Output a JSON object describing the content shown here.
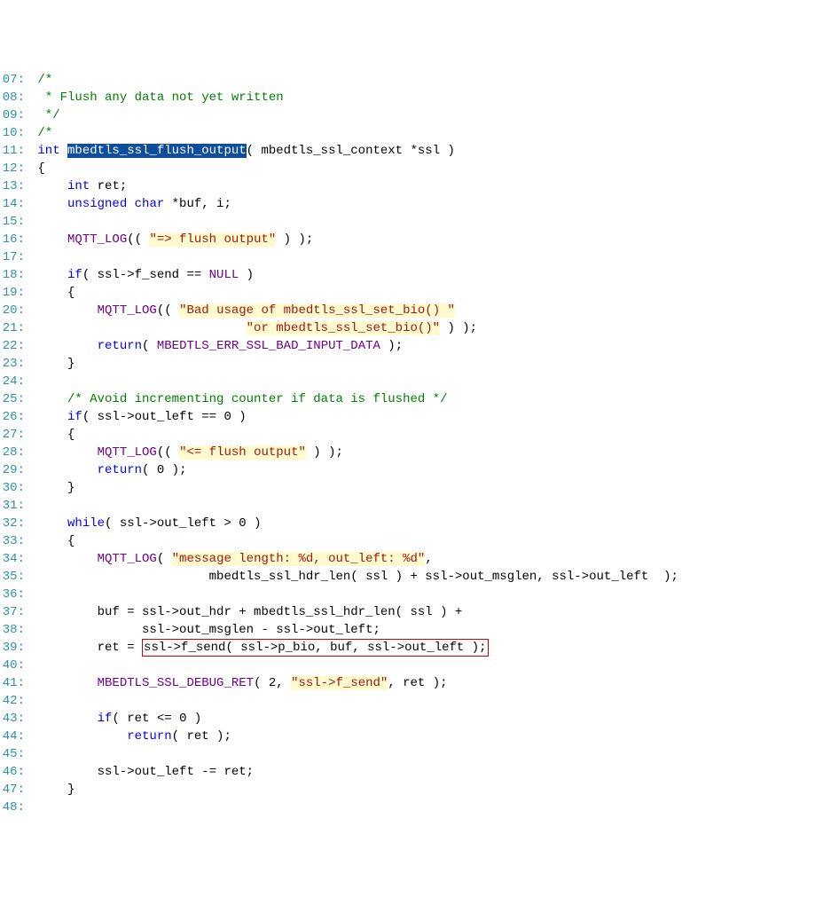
{
  "lines": [
    {
      "n": "07:",
      "prefix": "",
      "tokens": [
        [
          "/*",
          "comment"
        ]
      ]
    },
    {
      "n": "08:",
      "prefix": "",
      "tokens": [
        [
          " * Flush any data not yet written",
          "comment"
        ]
      ]
    },
    {
      "n": "09:",
      "prefix": "",
      "tokens": [
        [
          " */",
          "comment"
        ]
      ]
    },
    {
      "n": "10:",
      "prefix": "",
      "tokens": [
        [
          "/*",
          "comment"
        ]
      ]
    },
    {
      "n": "11:",
      "prefix": "",
      "tokens": [
        [
          "int ",
          "keyword"
        ],
        [
          "mbedtls_ssl_flush_output",
          "select"
        ],
        [
          "( mbedtls_ssl_context *ssl )",
          "text"
        ]
      ]
    },
    {
      "n": "12:",
      "prefix": "",
      "tokens": [
        [
          "{",
          "text"
        ]
      ]
    },
    {
      "n": "13:",
      "prefix": "    ",
      "tokens": [
        [
          "int",
          "keyword"
        ],
        [
          " ret;",
          "text"
        ]
      ]
    },
    {
      "n": "14:",
      "prefix": "    ",
      "tokens": [
        [
          "unsigned",
          "keyword"
        ],
        [
          " ",
          "text"
        ],
        [
          "char",
          "keyword"
        ],
        [
          " *buf, i;",
          "text"
        ]
      ]
    },
    {
      "n": "15:",
      "prefix": "",
      "tokens": [
        [
          "",
          "text"
        ]
      ]
    },
    {
      "n": "16:",
      "prefix": "    ",
      "tokens": [
        [
          "MQTT_LOG",
          "macro"
        ],
        [
          "(( ",
          "text"
        ],
        [
          "\"=> flush output\"",
          "string hl"
        ],
        [
          " ) );",
          "text"
        ]
      ]
    },
    {
      "n": "17:",
      "prefix": "",
      "tokens": [
        [
          "",
          "text"
        ]
      ]
    },
    {
      "n": "18:",
      "prefix": "    ",
      "tokens": [
        [
          "if",
          "keyword"
        ],
        [
          "( ssl->f_send == ",
          "text"
        ],
        [
          "NULL",
          "macro"
        ],
        [
          " )",
          "text"
        ]
      ]
    },
    {
      "n": "19:",
      "prefix": "    ",
      "tokens": [
        [
          "{",
          "text"
        ]
      ]
    },
    {
      "n": "20:",
      "prefix": "        ",
      "tokens": [
        [
          "MQTT_LOG",
          "macro"
        ],
        [
          "(( ",
          "text"
        ],
        [
          "\"Bad usage of mbedtls_ssl_set_bio() \"",
          "string hl"
        ]
      ]
    },
    {
      "n": "21:",
      "prefix": "                            ",
      "tokens": [
        [
          "\"or mbedtls_ssl_set_bio()\"",
          "string hl"
        ],
        [
          " ) );",
          "text"
        ]
      ]
    },
    {
      "n": "22:",
      "prefix": "        ",
      "tokens": [
        [
          "return",
          "keyword"
        ],
        [
          "( ",
          "text"
        ],
        [
          "MBEDTLS_ERR_SSL_BAD_INPUT_DATA",
          "macro"
        ],
        [
          " );",
          "text"
        ]
      ]
    },
    {
      "n": "23:",
      "prefix": "    ",
      "tokens": [
        [
          "}",
          "text"
        ]
      ]
    },
    {
      "n": "24:",
      "prefix": "",
      "tokens": [
        [
          "",
          "text"
        ]
      ]
    },
    {
      "n": "25:",
      "prefix": "    ",
      "tokens": [
        [
          "/* Avoid incrementing counter if data is flushed */",
          "comment"
        ]
      ]
    },
    {
      "n": "26:",
      "prefix": "    ",
      "tokens": [
        [
          "if",
          "keyword"
        ],
        [
          "( ssl->out_left == ",
          "text"
        ],
        [
          "0",
          "number"
        ],
        [
          " )",
          "text"
        ]
      ]
    },
    {
      "n": "27:",
      "prefix": "    ",
      "tokens": [
        [
          "{",
          "text"
        ]
      ]
    },
    {
      "n": "28:",
      "prefix": "        ",
      "tokens": [
        [
          "MQTT_LOG",
          "macro"
        ],
        [
          "(( ",
          "text"
        ],
        [
          "\"<= flush output\"",
          "string hl"
        ],
        [
          " ) );",
          "text"
        ]
      ]
    },
    {
      "n": "29:",
      "prefix": "        ",
      "tokens": [
        [
          "return",
          "keyword"
        ],
        [
          "( ",
          "text"
        ],
        [
          "0",
          "number"
        ],
        [
          " );",
          "text"
        ]
      ]
    },
    {
      "n": "30:",
      "prefix": "    ",
      "tokens": [
        [
          "}",
          "text"
        ]
      ]
    },
    {
      "n": "31:",
      "prefix": "",
      "tokens": [
        [
          "",
          "text"
        ]
      ]
    },
    {
      "n": "32:",
      "prefix": "    ",
      "tokens": [
        [
          "while",
          "keyword"
        ],
        [
          "( ssl->out_left > ",
          "text"
        ],
        [
          "0",
          "number"
        ],
        [
          " )",
          "text"
        ]
      ]
    },
    {
      "n": "33:",
      "prefix": "    ",
      "tokens": [
        [
          "{",
          "text"
        ]
      ]
    },
    {
      "n": "34:",
      "prefix": "        ",
      "tokens": [
        [
          "MQTT_LOG",
          "macro"
        ],
        [
          "( ",
          "text"
        ],
        [
          "\"message length: %d, out_left: %d\"",
          "string hl"
        ],
        [
          ",",
          "text"
        ]
      ]
    },
    {
      "n": "35:",
      "prefix": "                       ",
      "tokens": [
        [
          "mbedtls_ssl_hdr_len( ssl ) + ssl->out_msglen, ssl->out_left  );",
          "text"
        ]
      ]
    },
    {
      "n": "36:",
      "prefix": "",
      "tokens": [
        [
          "",
          "text"
        ]
      ]
    },
    {
      "n": "37:",
      "prefix": "        ",
      "tokens": [
        [
          "buf = ssl->out_hdr + mbedtls_ssl_hdr_len( ssl ) +",
          "text"
        ]
      ]
    },
    {
      "n": "38:",
      "prefix": "              ",
      "tokens": [
        [
          "ssl->out_msglen - ssl->out_left;",
          "text"
        ]
      ]
    },
    {
      "n": "39:red",
      "prefix": "        ",
      "tokens": [
        [
          "ret = ",
          "text"
        ],
        [
          "ssl->f_send( ssl->p_bio, buf, ssl->out_left );",
          "text"
        ]
      ]
    },
    {
      "n": "40:",
      "prefix": "",
      "tokens": [
        [
          "",
          "text"
        ]
      ]
    },
    {
      "n": "41:",
      "prefix": "        ",
      "tokens": [
        [
          "MBEDTLS_SSL_DEBUG_RET",
          "macro"
        ],
        [
          "( ",
          "text"
        ],
        [
          "2",
          "number"
        ],
        [
          ", ",
          "text"
        ],
        [
          "\"ssl->f_send\"",
          "string hl"
        ],
        [
          ", ret );",
          "text"
        ]
      ]
    },
    {
      "n": "42:",
      "prefix": "",
      "tokens": [
        [
          "",
          "text"
        ]
      ]
    },
    {
      "n": "43:",
      "prefix": "        ",
      "tokens": [
        [
          "if",
          "keyword"
        ],
        [
          "( ret <= ",
          "text"
        ],
        [
          "0",
          "number"
        ],
        [
          " )",
          "text"
        ]
      ]
    },
    {
      "n": "44:",
      "prefix": "            ",
      "tokens": [
        [
          "return",
          "keyword"
        ],
        [
          "( ret );",
          "text"
        ]
      ]
    },
    {
      "n": "45:",
      "prefix": "",
      "tokens": [
        [
          "",
          "text"
        ]
      ]
    },
    {
      "n": "46:",
      "prefix": "        ",
      "tokens": [
        [
          "ssl->out_left -= ret;",
          "text"
        ]
      ]
    },
    {
      "n": "47:",
      "prefix": "    ",
      "tokens": [
        [
          "}",
          "text"
        ]
      ]
    },
    {
      "n": "48:",
      "prefix": "",
      "tokens": [
        [
          "",
          "text"
        ]
      ]
    }
  ]
}
